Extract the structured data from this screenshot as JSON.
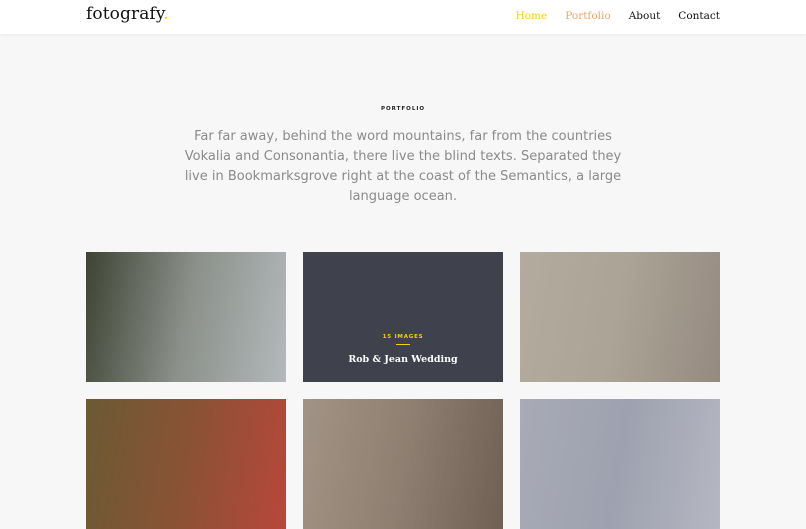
{
  "brand": {
    "name": "fotografy",
    "dot": ".",
    "accent_color": "#f5d10a"
  },
  "nav": {
    "items": [
      {
        "label": "Home",
        "color": "#f5d10a"
      },
      {
        "label": "Portfolio",
        "color": "#f4a466"
      },
      {
        "label": "About",
        "color": "#111111"
      },
      {
        "label": "Contact",
        "color": "#111111"
      }
    ]
  },
  "portfolio": {
    "section_label": "PORTFOLIO",
    "intro": "Far far away, behind the word mountains, far from the countries Vokalia and Consonantia, there live the blind texts. Separated they live in Bookmarksgrove right at the coast of the Semantics, a large language ocean.",
    "tiles": [
      {
        "colors": [
          "#3d4433",
          "#8b908a",
          "#b3b9bb"
        ]
      },
      {
        "overlay_color": "#3f424d",
        "count": "15 IMAGES",
        "title": "Rob & Jean Wedding"
      },
      {
        "colors": [
          "#b3ab9e",
          "#aba396",
          "#958a80"
        ]
      },
      {
        "colors": [
          "#6b5a34",
          "#8a5235",
          "#b8473a"
        ]
      },
      {
        "colors": [
          "#a19385",
          "#8f7f72",
          "#6f5f54"
        ]
      },
      {
        "colors": [
          "#a8aab6",
          "#9ea1af",
          "#b5b7c2"
        ]
      }
    ]
  }
}
